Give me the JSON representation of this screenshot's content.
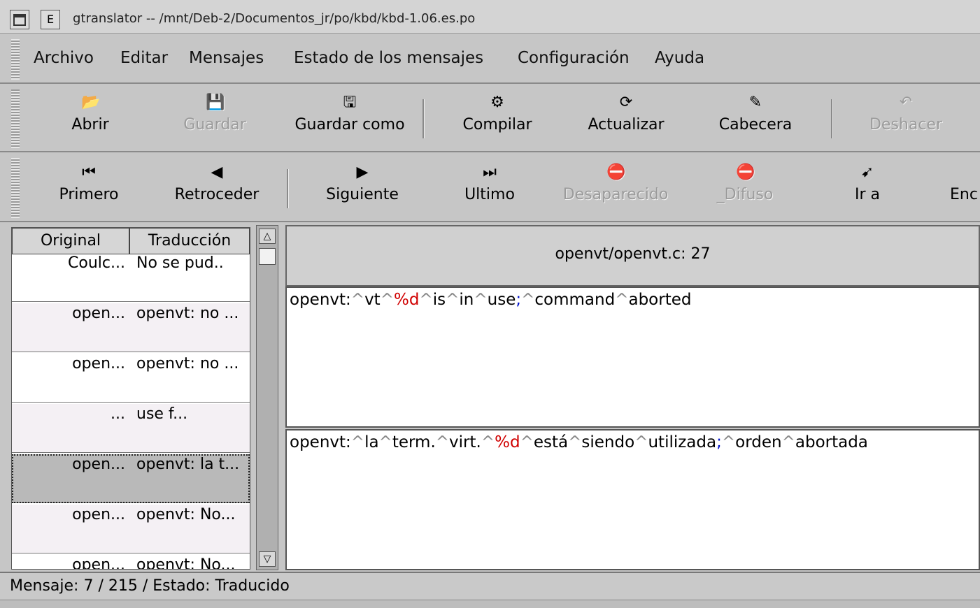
{
  "window": {
    "title": "gtranslator -- /mnt/Deb-2/Documentos_jr/po/kbd/kbd-1.06.es.po",
    "btn_min": "",
    "btn_e": "E"
  },
  "menubar": [
    "Archivo",
    "Editar",
    "Mensajes",
    "Estado de los mensajes",
    "Configuración",
    "Ayuda"
  ],
  "toolbar1": [
    {
      "label": "Abrir",
      "icon": "open-icon",
      "glyph": "📂",
      "enabled": true
    },
    {
      "label": "Guardar",
      "icon": "save-icon",
      "glyph": "💾",
      "enabled": false
    },
    {
      "label": "Guardar como",
      "icon": "save-as-icon",
      "glyph": "🖫",
      "enabled": true
    },
    {
      "label": "Compilar",
      "icon": "compile-icon",
      "glyph": "⚙",
      "enabled": true
    },
    {
      "label": "Actualizar",
      "icon": "update-icon",
      "glyph": "⟳",
      "enabled": true
    },
    {
      "label": "Cabecera",
      "icon": "header-icon",
      "glyph": "✎",
      "enabled": true
    },
    {
      "label": "Deshacer",
      "icon": "undo-icon",
      "glyph": "↶",
      "enabled": false
    }
  ],
  "toolbar2": [
    {
      "label": "Primero",
      "icon": "first-icon",
      "glyph": "⏮",
      "enabled": true
    },
    {
      "label": "Retroceder",
      "icon": "back-icon",
      "glyph": "◀",
      "enabled": true
    },
    {
      "label": "Siguiente",
      "icon": "next-icon",
      "glyph": "▶",
      "enabled": true
    },
    {
      "label": "Ultimo",
      "icon": "last-icon",
      "glyph": "⏭",
      "enabled": true
    },
    {
      "label": "Desaparecido",
      "icon": "missing-icon",
      "glyph": "⛔",
      "enabled": false
    },
    {
      "label": "_Difuso",
      "icon": "fuzzy-icon",
      "glyph": "⛔",
      "enabled": false
    },
    {
      "label": "Ir a",
      "icon": "goto-icon",
      "glyph": "➹",
      "enabled": true
    },
    {
      "label": "Enc",
      "icon": "find-icon",
      "glyph": "",
      "enabled": true
    }
  ],
  "list": {
    "col_original": "Original",
    "col_translation": "Traducción",
    "rows": [
      {
        "original": "Coulc...",
        "translation": "No se pud..",
        "style": "normal"
      },
      {
        "original": "open...",
        "translation": "openvt: no ...",
        "style": "alt"
      },
      {
        "original": "open...",
        "translation": "openvt: no ...",
        "style": "normal"
      },
      {
        "original": "...",
        "translation": "use f...",
        "style": "alt"
      },
      {
        "original": "open...",
        "translation": "openvt: la t...",
        "style": "sel"
      },
      {
        "original": "open...",
        "translation": "openvt: No...",
        "style": "alt"
      },
      {
        "original": "open...",
        "translation": "openvt: No...",
        "style": "normal"
      }
    ]
  },
  "location": "openvt/openvt.c: 27",
  "original_text": [
    {
      "t": "openvt:",
      "k": "n"
    },
    {
      "t": "^",
      "k": "c"
    },
    {
      "t": "vt",
      "k": "n"
    },
    {
      "t": "^",
      "k": "c"
    },
    {
      "t": "%d",
      "k": "r"
    },
    {
      "t": "^",
      "k": "c"
    },
    {
      "t": "is",
      "k": "n"
    },
    {
      "t": "^",
      "k": "c"
    },
    {
      "t": "in",
      "k": "n"
    },
    {
      "t": "^",
      "k": "c"
    },
    {
      "t": "use",
      "k": "n"
    },
    {
      "t": ";",
      "k": "b"
    },
    {
      "t": "^",
      "k": "c"
    },
    {
      "t": "command",
      "k": "n"
    },
    {
      "t": "^",
      "k": "c"
    },
    {
      "t": "aborted",
      "k": "n"
    }
  ],
  "translation_text": [
    {
      "t": "openvt:",
      "k": "n"
    },
    {
      "t": "^",
      "k": "c"
    },
    {
      "t": "la",
      "k": "n"
    },
    {
      "t": "^",
      "k": "c"
    },
    {
      "t": "term.",
      "k": "n"
    },
    {
      "t": "^",
      "k": "c"
    },
    {
      "t": "virt.",
      "k": "n"
    },
    {
      "t": "^",
      "k": "c"
    },
    {
      "t": "%d",
      "k": "r"
    },
    {
      "t": "^",
      "k": "c"
    },
    {
      "t": "está",
      "k": "n"
    },
    {
      "t": "^",
      "k": "c"
    },
    {
      "t": "siendo",
      "k": "n"
    },
    {
      "t": "^",
      "k": "c"
    },
    {
      "t": "utilizada",
      "k": "n"
    },
    {
      "t": ";",
      "k": "b"
    },
    {
      "t": "^",
      "k": "c"
    },
    {
      "t": "orden",
      "k": "n"
    },
    {
      "t": "^",
      "k": "c"
    },
    {
      "t": "abortada",
      "k": "n"
    }
  ],
  "status": "Mensaje: 7 / 215 / Estado: Traducido",
  "colors": {
    "format_spec": "#d00000",
    "space_marker": "#888888",
    "punct": "#0011cc"
  }
}
